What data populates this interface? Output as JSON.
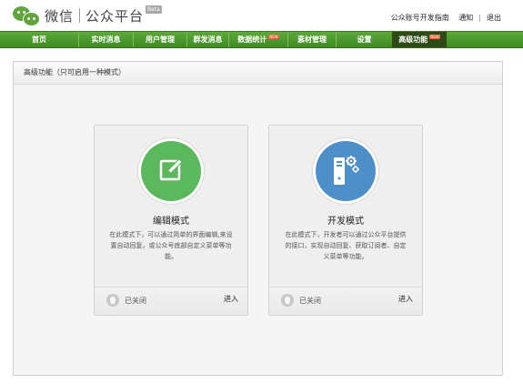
{
  "header": {
    "logo_text": "微信",
    "logo_sub": "公众平台",
    "beta": "Beta",
    "links": [
      "公众账号开发指南",
      "通知",
      "退出"
    ]
  },
  "nav": {
    "items": [
      {
        "label": "首页"
      },
      {
        "label": "实时消息"
      },
      {
        "label": "用户管理"
      },
      {
        "label": "群发消息"
      },
      {
        "label": "数据统计",
        "badge": "NEW"
      },
      {
        "label": "素材管理"
      },
      {
        "label": "设置"
      },
      {
        "label": "高级功能",
        "badge": "NEW",
        "active": true
      }
    ]
  },
  "panel": {
    "title": "高级功能（只可启用一种模式）"
  },
  "cards": [
    {
      "title": "编辑模式",
      "description": "在此模式下，可以通过简单的界面编辑,来设置自动回复，或公众号底部自定义菜单等功能。",
      "status": "已关闭",
      "action": "进入",
      "icon": "edit-icon",
      "color": "#5cb85c"
    },
    {
      "title": "开发模式",
      "description": "在此模式下，开发者可以通过公众平台提供的接口，实现自动回复、获取订阅者、自定义菜单等功能。",
      "status": "已关闭",
      "action": "进入",
      "icon": "server-icon",
      "color": "#4f8fc8"
    }
  ],
  "colors": {
    "brand_green": "#4a9a2c",
    "nav_active": "#2e4a16",
    "badge_red": "#e85d3a"
  }
}
